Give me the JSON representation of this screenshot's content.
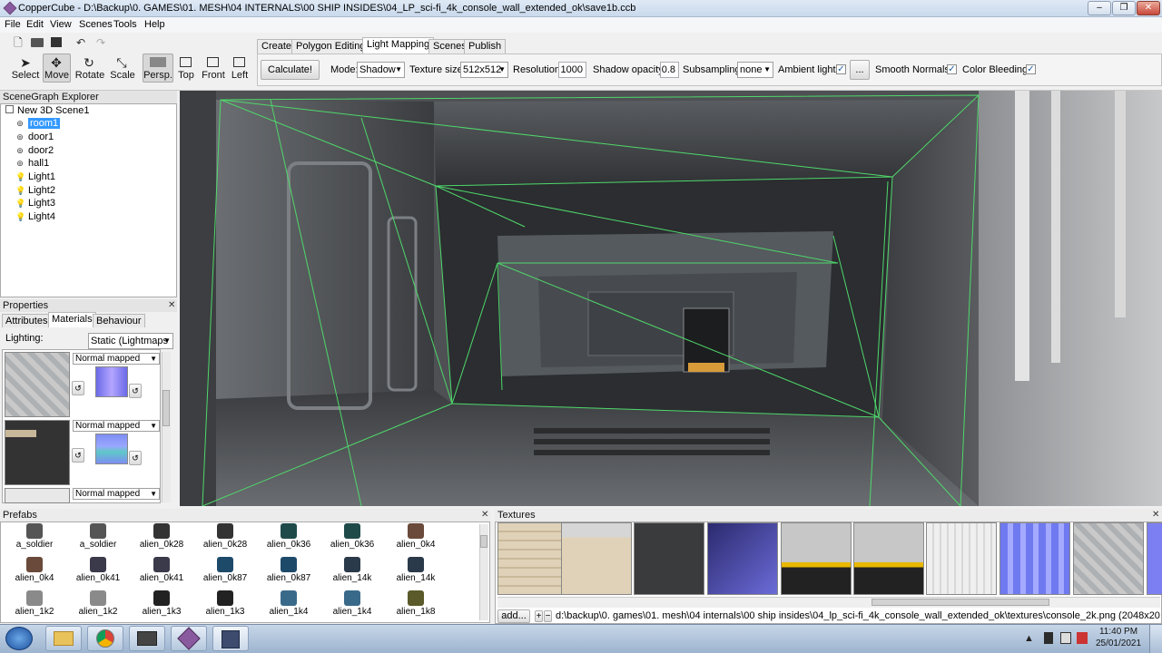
{
  "window": {
    "title": "CopperCube - D:\\Backup\\0. GAMES\\01. MESH\\04 INTERNALS\\00 SHIP INSIDES\\04_LP_sci-fi_4k_console_wall_extended_ok\\save1b.ccb",
    "minimize": "–",
    "maximize": "❐",
    "close": "✕"
  },
  "menu": [
    "File",
    "Edit",
    "View",
    "Scenes",
    "Tools",
    "Help"
  ],
  "tools": {
    "select": "Select",
    "move": "Move",
    "rotate": "Rotate",
    "scale": "Scale",
    "persp": "Persp.",
    "top": "Top",
    "front": "Front",
    "left": "Left"
  },
  "tabs": [
    "Create",
    "Polygon Editing",
    "Light Mapping",
    "Scenes",
    "Publish"
  ],
  "active_tab": "Light Mapping",
  "lightmapping": {
    "calculate": "Calculate!",
    "mode_label": "Mode:",
    "mode_value": "Shadow",
    "texsize_label": "Texture size:",
    "texsize_value": "512x512",
    "resolution_label": "Resolution:",
    "resolution_value": "1000",
    "shadow_opacity_label": "Shadow opacity:",
    "shadow_opacity_value": "0.8",
    "subsampling_label": "Subsampling:",
    "subsampling_value": "none",
    "ambient_label": "Ambient light:",
    "ambient_checked": "✓",
    "ambient_button": "...",
    "smooth_label": "Smooth Normals:",
    "smooth_checked": "✓",
    "bleeding_label": "Color Bleeding:",
    "bleeding_checked": "✓"
  },
  "scenegraph": {
    "title": "SceneGraph Explorer",
    "root": "New 3D Scene1",
    "items": [
      "room1",
      "door1",
      "door2",
      "hall1",
      "Light1",
      "Light2",
      "Light3",
      "Light4"
    ],
    "selected": "room1"
  },
  "properties": {
    "title": "Properties",
    "close": "✕",
    "tabs": [
      "Attributes",
      "Materials",
      "Behaviour"
    ],
    "active_tab": "Materials",
    "lighting_label": "Lighting:",
    "lighting_value": "Static (Lightmaps",
    "material_type": [
      "Normal mapped",
      "Normal mapped",
      "Normal mapped"
    ]
  },
  "prefabs": {
    "title": "Prefabs",
    "close": "✕",
    "items": [
      "a_soldier",
      "a_soldier",
      "alien_0k28",
      "alien_0k28",
      "alien_0k36",
      "alien_0k36",
      "alien_0k4",
      "alien_0k4",
      "alien_0k41",
      "alien_0k41",
      "alien_0k87",
      "alien_0k87",
      "alien_14k",
      "alien_14k",
      "alien_1k2",
      "alien_1k2",
      "alien_1k3",
      "alien_1k3",
      "alien_1k4",
      "alien_1k4",
      "alien_1k8"
    ]
  },
  "textures": {
    "title": "Textures",
    "close": "✕",
    "add_button": "add...",
    "path": "d:\\backup\\0. games\\01. mesh\\04 internals\\00 ship insides\\04_lp_sci-fi_4k_console_wall_extended_ok\\textures\\console_2k.png (2048x2048)"
  },
  "taskbar": {
    "time": "11:40 PM",
    "date": "25/01/2021"
  },
  "colors": {
    "selection": "#3399ff",
    "wireframe": "#4fd86b",
    "titlebar": "#c9d9ec"
  }
}
